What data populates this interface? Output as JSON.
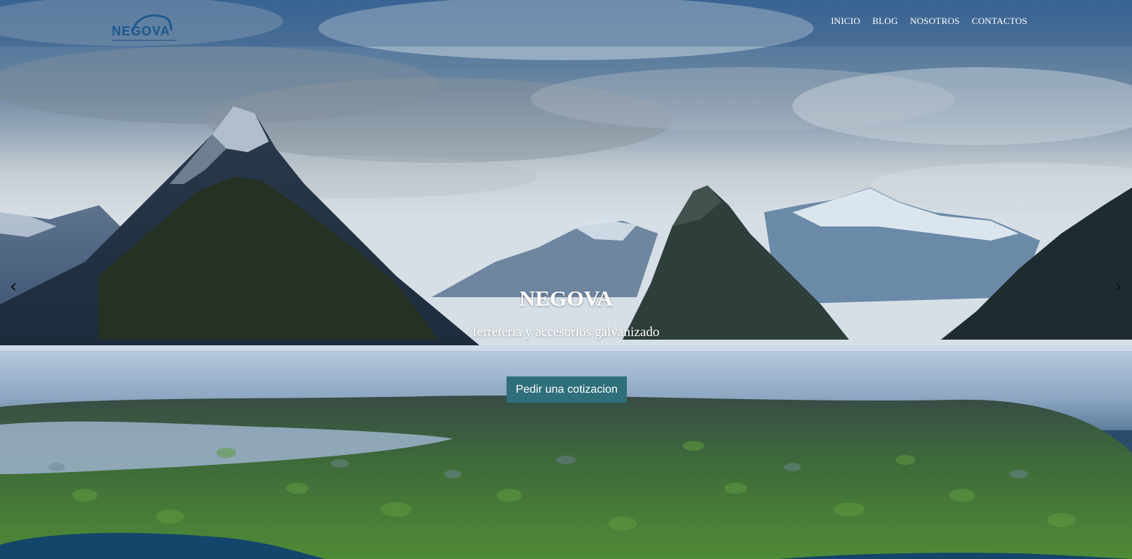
{
  "brand": {
    "logo_text": "NEGOVA"
  },
  "nav": {
    "items": [
      {
        "label": "INICIO"
      },
      {
        "label": "BLOG"
      },
      {
        "label": "NOSOTROS"
      },
      {
        "label": "CONTACTOS"
      }
    ]
  },
  "hero": {
    "title": "NEGOVA",
    "subtitle": "ferreteria y accesorios galvanizado",
    "cta_label": "Pedir una cotizacion",
    "prev_arrow": "‹",
    "next_arrow": "›"
  },
  "colors": {
    "cta_background": "#2e6f7a",
    "logo_blue": "#1b5a8e",
    "nav_text": "#ffffff",
    "bottom_wave": "#12466a"
  },
  "icons": {
    "prev": "chevron-left-icon",
    "next": "chevron-right-icon"
  }
}
